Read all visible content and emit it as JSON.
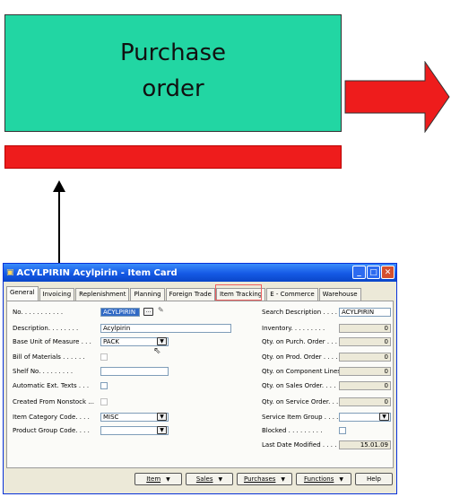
{
  "diagram": {
    "purchase_order_line1": "Purchase",
    "purchase_order_line2": "order"
  },
  "window": {
    "title": "ACYLPIRIN Acylpirin - Item Card",
    "tabs": [
      "General",
      "Invoicing",
      "Replenishment",
      "Planning",
      "Foreign Trade",
      "Item Tracking",
      "E - Commerce",
      "Warehouse"
    ],
    "active_tab": "General",
    "highlighted_tab": "Item Tracking",
    "left": {
      "no_label": "No. . . . . . . . . . .",
      "no_value": "ACYLPIRIN",
      "description_label": "Description. . . . . . . .",
      "description_value": "Acylpirin",
      "base_uom_label": "Base Unit of Measure . . .",
      "base_uom_value": "PACK",
      "bom_label": "Bill of Materials . . . . . .",
      "shelf_label": "Shelf No. . . . . . . . .",
      "shelf_value": "",
      "auto_ext_label": "Automatic Ext. Texts . . .",
      "created_label": "Created From Nonstock ...",
      "item_cat_label": "Item Category Code. . . .",
      "item_cat_value": "MISC",
      "product_group_label": "Product Group Code. . . .",
      "product_group_value": ""
    },
    "right": {
      "search_desc_label": "Search Description . . . .",
      "search_desc_value": "ACYLPIRIN",
      "inventory_label": "Inventory. . . . . . . . .",
      "inventory_value": "0",
      "qty_purch_label": "Qty. on Purch. Order . . .",
      "qty_purch_value": "0",
      "qty_prod_label": "Qty. on Prod. Order . . . .",
      "qty_prod_value": "0",
      "qty_comp_label": "Qty. on Component Lines .",
      "qty_comp_value": "0",
      "qty_sales_label": "Qty. on Sales Order. . . .",
      "qty_sales_value": "0",
      "qty_service_label": "Qty. on Service Order. . .",
      "qty_service_value": "0",
      "service_group_label": "Service Item Group . . . .",
      "service_group_value": "",
      "blocked_label": "Blocked . . . . . . . . .",
      "last_modified_label": "Last Date Modified . . . .",
      "last_modified_value": "15.01.09"
    },
    "buttons": {
      "item": "Item",
      "sales": "Sales",
      "purchases": "Purchases",
      "functions": "Functions",
      "help": "Help"
    }
  },
  "colors": {
    "po_box": "#22d6a3",
    "red": "#ee1c1c",
    "titlebar": "#1559e5"
  }
}
